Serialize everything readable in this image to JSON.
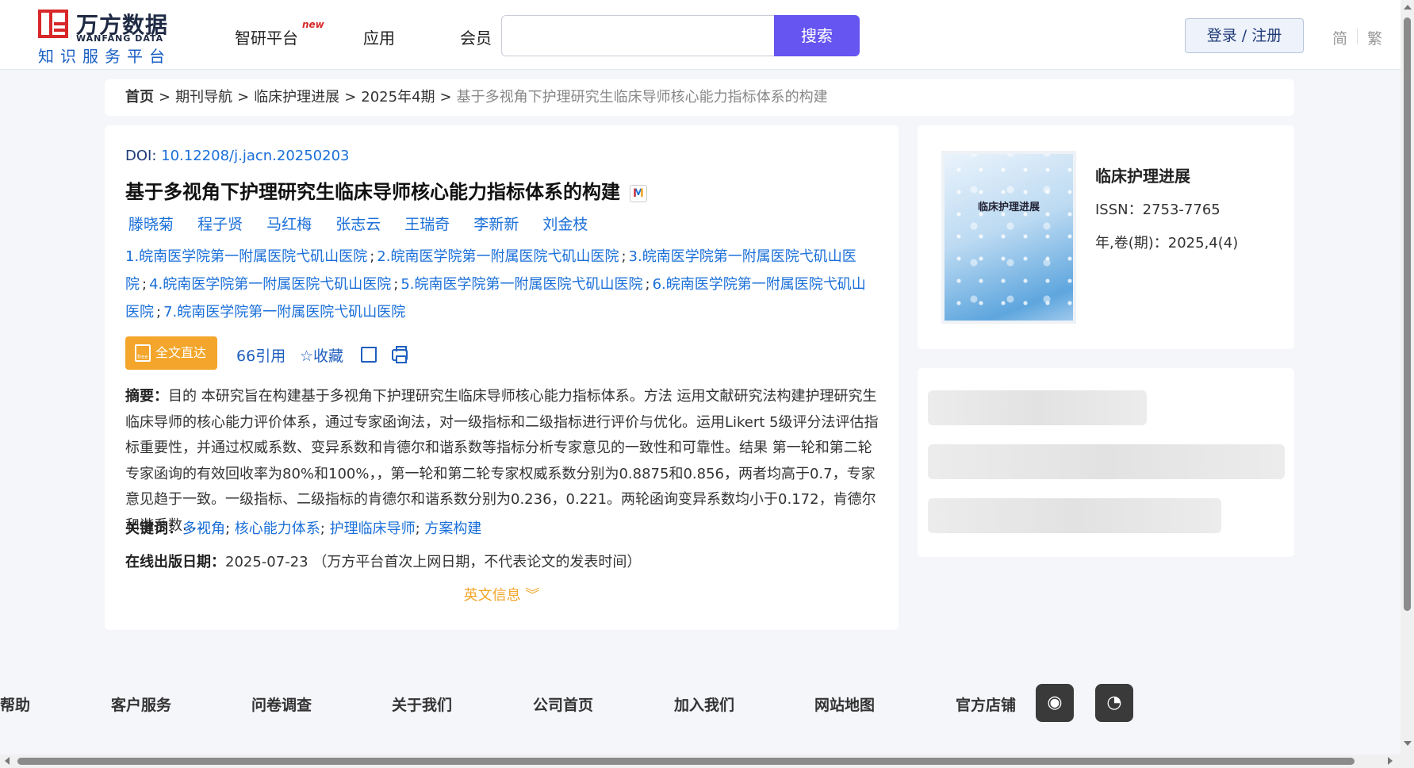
{
  "header": {
    "logo_cn": "万方数据",
    "logo_en": "WANFANG DATA",
    "logo_sub": "知识服务平台",
    "nav": [
      {
        "label": "智研平台",
        "badge": "new"
      },
      {
        "label": "应用"
      },
      {
        "label": "会员"
      }
    ],
    "search": {
      "value": "",
      "placeholder": "",
      "button_label": "搜索"
    },
    "login_label": "登录 / 注册",
    "lang_simplified": "简",
    "lang_traditional": "繁",
    "accent_color": "#6655f0"
  },
  "breadcrumb": {
    "home": "首页",
    "items": [
      "期刊导航",
      "临床护理进展",
      "2025年4期"
    ],
    "current": "基于多视角下护理研究生临床导师核心能力指标体系的构建",
    "separator": ">"
  },
  "article": {
    "doi_label": "DOI:",
    "doi": "10.12208/j.jacn.20250203",
    "title": "基于多视角下护理研究生临床导师核心能力指标体系的构建",
    "title_badge": "M",
    "authors": [
      "滕晓菊",
      "程子贤",
      "马红梅",
      "张志云",
      "王瑞奇",
      "李新新",
      "刘金枝"
    ],
    "affiliations": [
      "1.皖南医学院第一附属医院弋矶山医院",
      "2.皖南医学院第一附属医院弋矶山医院",
      "3.皖南医学院第一附属医院弋矶山医院",
      "4.皖南医学院第一附属医院弋矶山医院",
      "5.皖南医学院第一附属医院弋矶山医院",
      "6.皖南医学院第一附属医院弋矶山医院",
      "7.皖南医学院第一附属医院弋矶山医院"
    ],
    "actions": {
      "fulltext": "全文直达",
      "fulltext_icon_text": "free",
      "cite": "引用",
      "favorite": "收藏"
    },
    "abstract_label": "摘要：",
    "abstract": "目的 本研究旨在构建基于多视角下护理研究生临床导师核心能力指标体系。方法 运用文献研究法构建护理研究生临床导师的核心能力评价体系，通过专家函询法，对一级指标和二级指标进行评价与优化。运用Likert 5级评分法评估指标重要性，并通过权威系数、变异系数和肯德尔和谐系数等指标分析专家意见的一致性和可靠性。结果 第一轮和第二轮专家函询的有效回收率为80%和100%，，第一轮和第二轮专家权威系数分别为0.8875和0.856，两者均高于0.7，专家意见趋于一致。一级指标、二级指标的肯德尔和谐系数分别为0.236，0.221。两轮函询变异系数均小于0.172，肯德尔和谐系数...",
    "keywords_label": "关键词：",
    "keywords": [
      "多视角",
      "核心能力体系",
      "护理临床导师",
      "方案构建"
    ],
    "pubdate_label": "在线出版日期：",
    "pubdate": "2025-07-23",
    "pubdate_note": "（万方平台首次上网日期，不代表论文的发表时间）",
    "english_info": "英文信息"
  },
  "journal": {
    "cover_title": "临床护理进展",
    "name": "临床护理进展",
    "issn": "ISSN：2753-7765",
    "volume": "年,卷(期)：2025,4(4)"
  },
  "footer": {
    "links": [
      "帮助",
      "客户服务",
      "问卷调查",
      "关于我们",
      "公司首页",
      "加入我们",
      "网站地图",
      "官方店铺"
    ],
    "social": [
      "weibo-icon",
      "wechat-icon"
    ]
  }
}
